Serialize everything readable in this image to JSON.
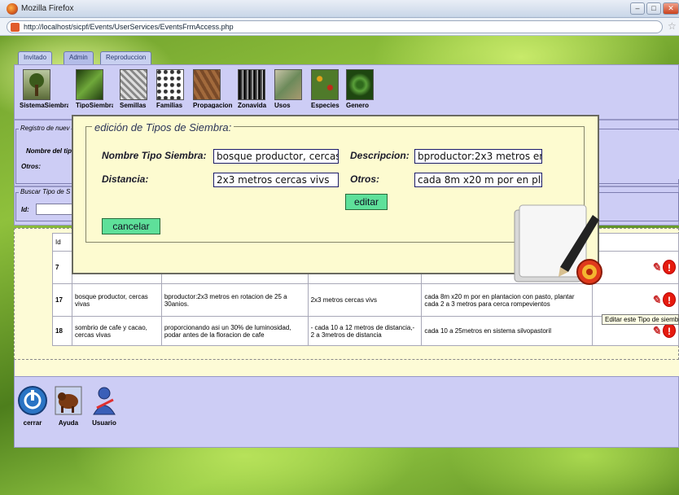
{
  "browser": {
    "title": "Mozilla Firefox",
    "url": "http://localhost/sicpf/Events/UserServices/EventsFrmAccess.php"
  },
  "tabs": [
    {
      "label": "Invitado"
    },
    {
      "label": "Admin"
    },
    {
      "label": "Reproduccion"
    }
  ],
  "toolbar": {
    "items": [
      {
        "label": "SistemaSiembra",
        "icon": "tree-icon"
      },
      {
        "label": "TipoSiembra",
        "icon": "plant-icon"
      },
      {
        "label": "Semillas",
        "icon": "seeds-icon"
      },
      {
        "label": "Familias",
        "icon": "family-icon"
      },
      {
        "label": "Propagacion",
        "icon": "propagation-icon"
      },
      {
        "label": "Zonavida",
        "icon": "forest-icon"
      },
      {
        "label": "Usos",
        "icon": "uses-icon"
      },
      {
        "label": "Especies",
        "icon": "species-icon"
      },
      {
        "label": "Genero",
        "icon": "genus-icon"
      }
    ]
  },
  "register": {
    "legend": "Registro de nuev",
    "name_label": "Nombre del tipo",
    "others_label": "Otros:"
  },
  "search": {
    "legend": "Buscar Tipo de S",
    "id_label": "Id:"
  },
  "modal": {
    "legend": "edición de Tipos de Siembra:",
    "name_label": "Nombre Tipo Siembra:",
    "name_value": "bosque productor, cercas",
    "desc_label": "Descripcion:",
    "desc_value": "bproductor:2x3 metros en",
    "distance_label": "Distancia:",
    "distance_value": "2x3 metros cercas vivs",
    "others_label": "Otros:",
    "others_value": "cada 8m x20 m por en pla",
    "edit_button": "editar",
    "cancel_button": "cancelar"
  },
  "table": {
    "header_id": "Id",
    "rows": [
      {
        "id": "7",
        "name": "",
        "description": "",
        "distance": "",
        "others": ""
      },
      {
        "id": "17",
        "name": "bosque productor, cercas vivas",
        "description": "bproductor:2x3 metros en rotacion de 25 a 30anios.",
        "distance": "2x3 metros cercas vivs",
        "others": "cada 8m x20 m por en plantacion con pasto, plantar cada 2 a 3 metros para cerca rompevientos"
      },
      {
        "id": "18",
        "name": "sombrio de cafe y cacao, cercas vivas",
        "description": "proporcionando asi un 30% de luminosidad, podar antes de la floracion de cafe",
        "distance": "- cada 10 a 12 metros de distancia,- 2 a 3metros de distancia",
        "others": "cada 10 a 25metros en sistema silvopastoril"
      }
    ]
  },
  "tooltip": "Editar este Tipo de siembra",
  "bottom": {
    "buttons": [
      {
        "label": "cerrar",
        "icon": "power-icon"
      },
      {
        "label": "Ayuda",
        "icon": "help-bull-icon"
      },
      {
        "label": "Usuario",
        "icon": "user-icon"
      }
    ]
  },
  "colors": {
    "panel": "#cdcdf5",
    "modal": "#fdfbd0",
    "button_green": "#5ee09a"
  }
}
